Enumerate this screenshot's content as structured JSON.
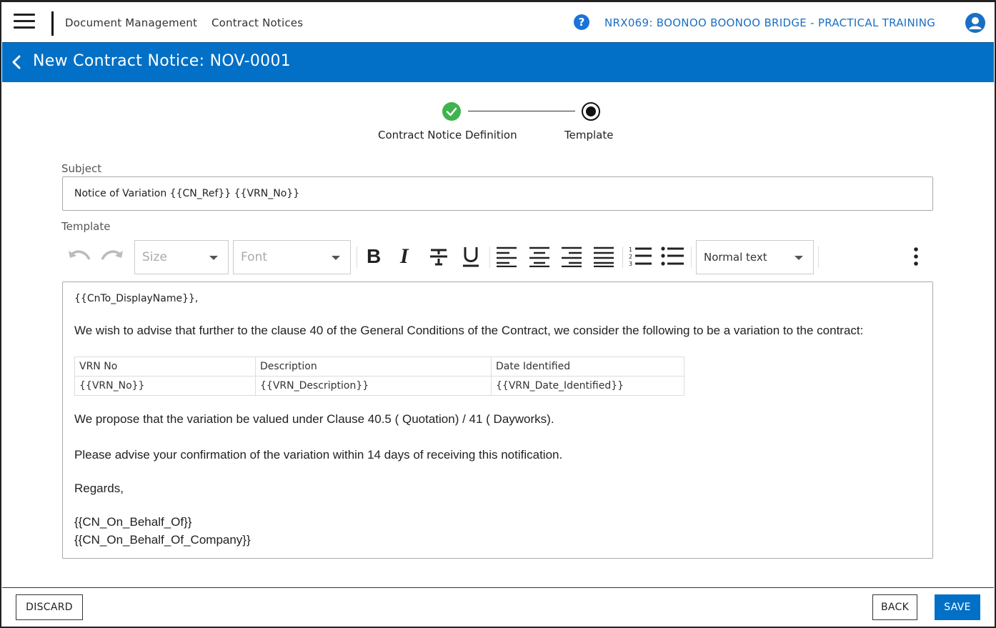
{
  "topbar": {
    "breadcrumb": [
      "Document Management",
      "Contract Notices"
    ],
    "project": "NRX069: BOONOO BOONOO BRIDGE - PRACTICAL TRAINING",
    "help_icon": "?"
  },
  "header": {
    "title": "New Contract Notice: NOV-0001"
  },
  "stepper": {
    "steps": [
      {
        "label": "Contract Notice Definition",
        "state": "completed"
      },
      {
        "label": "Template",
        "state": "current"
      }
    ]
  },
  "subject": {
    "label": "Subject",
    "value": "Notice of Variation {{CN_Ref}} {{VRN_No}}"
  },
  "template": {
    "label": "Template",
    "toolbar": {
      "size_placeholder": "Size",
      "font_placeholder": "Font",
      "block_format": "Normal text",
      "icons": [
        "undo-icon",
        "redo-icon",
        "bold-icon",
        "italic-icon",
        "strikethrough-icon",
        "underline-icon",
        "align-left-icon",
        "align-center-icon",
        "align-right-icon",
        "align-justify-icon",
        "ordered-list-icon",
        "bullet-list-icon",
        "more-vertical-icon"
      ]
    },
    "body": {
      "greeting": "{{CnTo_DisplayName}},",
      "intro": "We wish to advise that further to the clause 40 of the General Conditions of the Contract, we consider the following to be a variation to the contract:",
      "table": {
        "headers": [
          "VRN No",
          "Description",
          "Date Identified"
        ],
        "rows": [
          [
            "{{VRN_No}}",
            "{{VRN_Description}}",
            "{{VRN_Date_Identified}}"
          ]
        ]
      },
      "proposal": "We propose that the variation be valued under Clause 40.5 ( Quotation) / 41 ( Dayworks).",
      "confirm": "Please advise your confirmation of the variation within 14 days of receiving this notification.",
      "regards": "Regards,",
      "sign1": "{{CN_On_Behalf_Of}}",
      "sign2": "{{CN_On_Behalf_Of_Company}}"
    }
  },
  "footer": {
    "discard": "DISCARD",
    "back": "BACK",
    "save": "SAVE"
  },
  "colors": {
    "primary": "#0270c6",
    "success": "#3fb34f",
    "link": "#1a6fc4"
  }
}
